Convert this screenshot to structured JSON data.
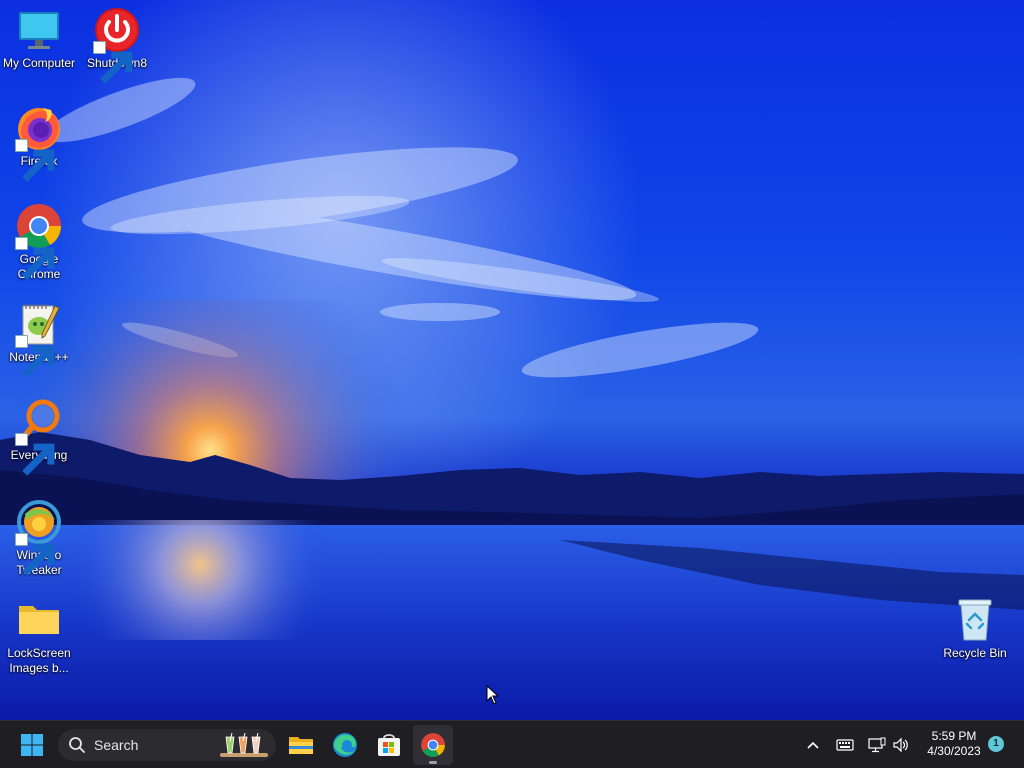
{
  "desktop": {
    "icons": [
      {
        "name": "my-computer",
        "label": "My Computer",
        "icon": "monitor-icon"
      },
      {
        "name": "shutdown8",
        "label": "Shutdown8",
        "icon": "power-icon"
      },
      {
        "name": "firefox",
        "label": "Firefox",
        "icon": "firefox-icon"
      },
      {
        "name": "google-chrome",
        "label": "Google Chrome",
        "icon": "chrome-icon"
      },
      {
        "name": "notepad-plus-plus",
        "label": "Notepad++",
        "icon": "notepad-icon"
      },
      {
        "name": "everything",
        "label": "Everything",
        "icon": "magnifier-icon"
      },
      {
        "name": "winaero-tweaker",
        "label": "Winaero Tweaker",
        "icon": "winaero-icon"
      },
      {
        "name": "lockscreen-images",
        "label": "LockScreen Images b...",
        "icon": "folder-icon"
      },
      {
        "name": "recycle-bin",
        "label": "Recycle Bin",
        "icon": "recycle-bin-icon"
      }
    ]
  },
  "taskbar": {
    "search_label": "Search",
    "pinned": [
      "start-icon",
      "file-explorer-icon",
      "edge-icon",
      "store-icon",
      "chrome-icon"
    ],
    "active_app": "Google Chrome"
  },
  "tray": {
    "time": "5:59 PM",
    "date": "4/30/2023",
    "notification_count": "1"
  },
  "colors": {
    "sky": "#0a2fd8",
    "taskbar": "#1f1f23",
    "accent": "#5ec8d8"
  }
}
